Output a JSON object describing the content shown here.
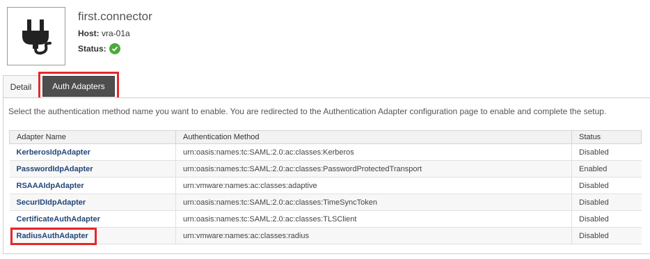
{
  "connector": {
    "title": "first.connector",
    "host_label": "Host:",
    "host_value": "vra-01a",
    "status_label": "Status:",
    "icon": "plug-icon",
    "status_icon": "check-circle-icon"
  },
  "tabs": [
    {
      "label": "Detail",
      "active": false
    },
    {
      "label": "Auth Adapters",
      "active": true
    }
  ],
  "panel": {
    "instructions": "Select the authentication method name you want to enable. You are redirected to the Authentication Adapter configuration page to enable and complete the setup."
  },
  "table": {
    "headers": [
      "Adapter Name",
      "Authentication Method",
      "Status"
    ],
    "rows": [
      {
        "name": "KerberosIdpAdapter",
        "method": "urn:oasis:names:tc:SAML:2.0:ac:classes:Kerberos",
        "status": "Disabled"
      },
      {
        "name": "PasswordIdpAdapter",
        "method": "urn:oasis:names:tc:SAML:2.0:ac:classes:PasswordProtectedTransport",
        "status": "Enabled"
      },
      {
        "name": "RSAAAIdpAdapter",
        "method": "urn:vmware:names:ac:classes:adaptive",
        "status": "Disabled"
      },
      {
        "name": "SecurIDIdpAdapter",
        "method": "urn:oasis:names:tc:SAML:2.0:ac:classes:TimeSyncToken",
        "status": "Disabled"
      },
      {
        "name": "CertificateAuthAdapter",
        "method": "urn:oasis:names:tc:SAML:2.0:ac:classes:TLSClient",
        "status": "Disabled"
      },
      {
        "name": "RadiusAuthAdapter",
        "method": "urn:vmware:names:ac:classes:radius",
        "status": "Disabled"
      }
    ]
  },
  "colors": {
    "highlight": "#e8262a",
    "active_tab": "#4e4e4e",
    "link": "#22477a",
    "status_ok": "#4caa3c"
  }
}
